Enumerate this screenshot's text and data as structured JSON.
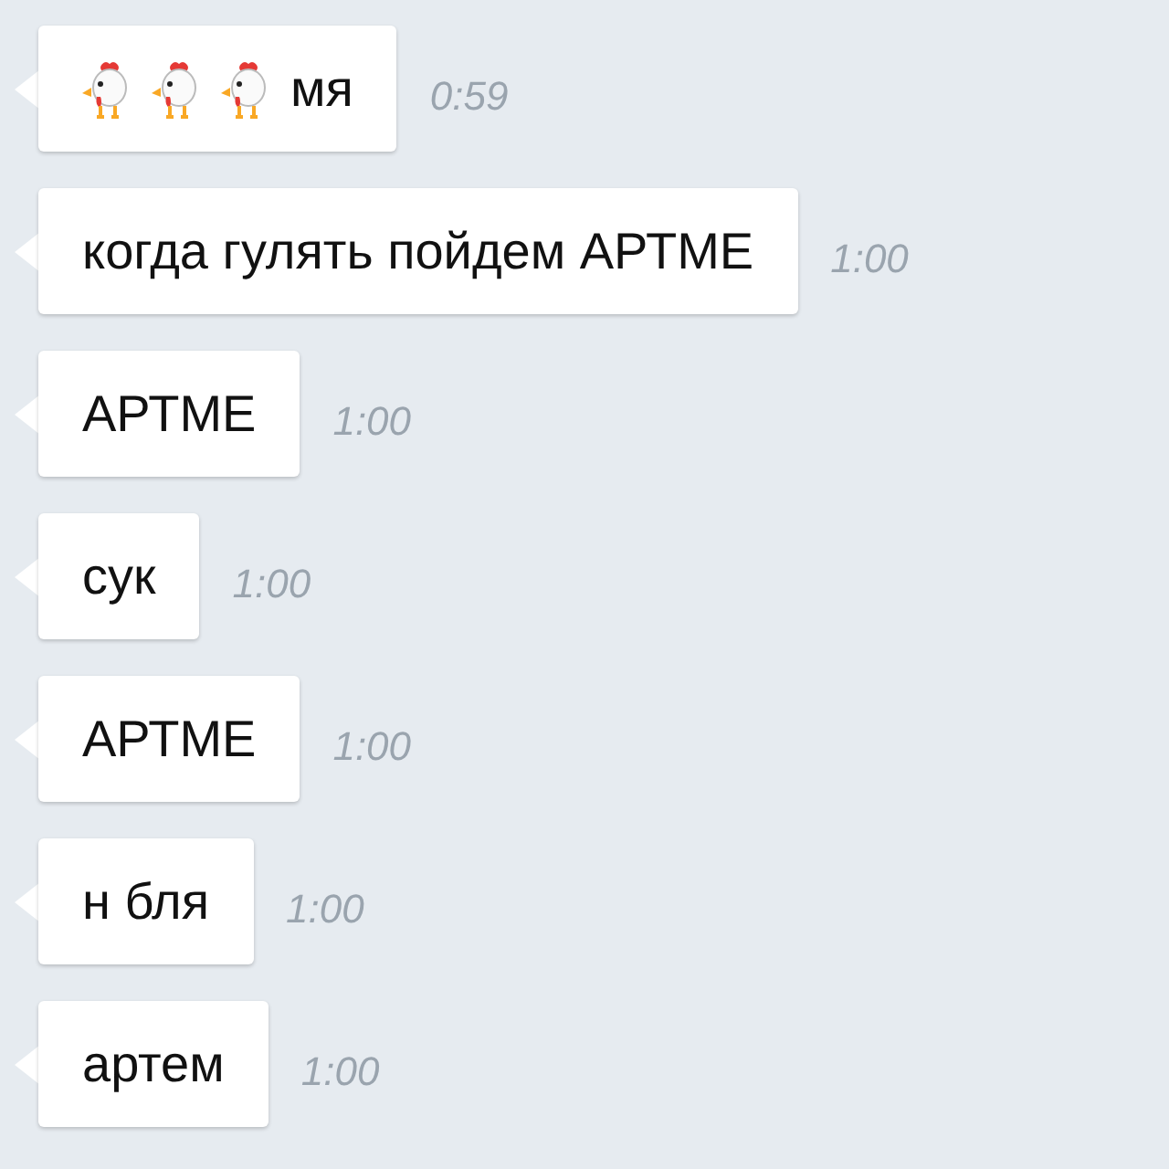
{
  "messages": [
    {
      "parts": [
        {
          "kind": "chicken"
        },
        {
          "kind": "chicken"
        },
        {
          "kind": "chicken"
        },
        {
          "kind": "text",
          "text": "мя"
        }
      ],
      "time": "0:59"
    },
    {
      "parts": [
        {
          "kind": "text",
          "text": "когда гулять пойдем АРТМЕ"
        }
      ],
      "time": "1:00"
    },
    {
      "parts": [
        {
          "kind": "text",
          "text": "АРТМЕ"
        }
      ],
      "time": "1:00"
    },
    {
      "parts": [
        {
          "kind": "text",
          "text": "сук"
        }
      ],
      "time": "1:00"
    },
    {
      "parts": [
        {
          "kind": "text",
          "text": "АРТМЕ"
        }
      ],
      "time": "1:00"
    },
    {
      "parts": [
        {
          "kind": "text",
          "text": "н бля"
        }
      ],
      "time": "1:00"
    },
    {
      "parts": [
        {
          "kind": "text",
          "text": "артем"
        }
      ],
      "time": "1:00"
    }
  ]
}
